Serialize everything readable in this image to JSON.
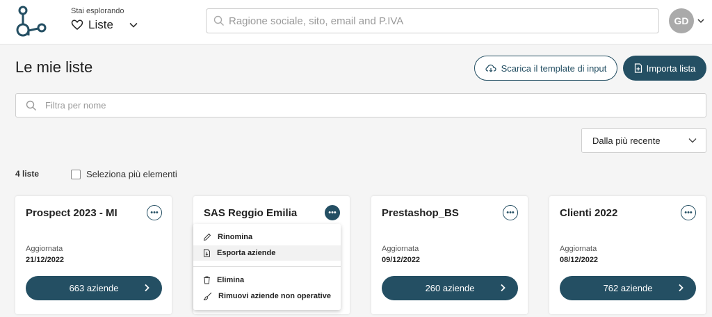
{
  "header": {
    "explore_label": "Stai esplorando",
    "explore_title": "Liste",
    "search_placeholder": "Ragione sociale, sito, email and P.IVA",
    "avatar_initials": "GD"
  },
  "page": {
    "title": "Le mie liste",
    "download_template_label": "Scarica il template di input",
    "import_list_label": "Importa lista",
    "filter_placeholder": "Filtra per nome",
    "sort_selected": "Dalla più recente",
    "count_label": "4 liste",
    "multi_select_label": "Seleziona più elementi"
  },
  "cards": [
    {
      "title": "Prospect 2023 - MI",
      "updated_label": "Aggiornata",
      "date": "21/12/2022",
      "button_label": "663 aziende"
    },
    {
      "title": "SAS Reggio Emilia"
    },
    {
      "title": "Prestashop_BS",
      "updated_label": "Aggiornata",
      "date": "09/12/2022",
      "button_label": "260 aziende"
    },
    {
      "title": "Clienti 2022",
      "updated_label": "Aggiornata",
      "date": "08/12/2022",
      "button_label": "762 aziende"
    }
  ],
  "menu": {
    "rename": "Rinomina",
    "export": "Esporta aziende",
    "delete": "Elimina",
    "remove_inactive": "Rimuovi aziende non operative"
  },
  "colors": {
    "primary": "#244f63",
    "background": "#f5f5f5"
  }
}
